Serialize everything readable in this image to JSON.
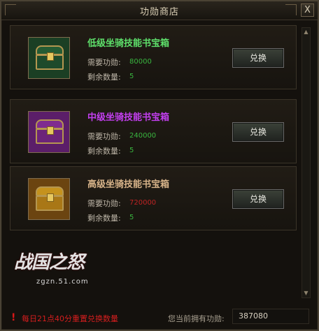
{
  "window": {
    "title": "功勋商店",
    "close_label": "X"
  },
  "items": [
    {
      "name": "低级坐骑技能书宝箱",
      "name_color": "#5ee06b",
      "icon": "green-treasure-chest-icon",
      "icon_colors": {
        "frame": "#1b3f24",
        "body": "#255c34"
      },
      "cost_label": "需要功勋:",
      "cost_value": "80000",
      "cost_color": "#39b53f",
      "remain_label": "剩余数量:",
      "remain_value": "5",
      "button_label": "兑换"
    },
    {
      "name": "中级坐骑技能书宝箱",
      "name_color": "#c33ff0",
      "icon": "purple-treasure-chest-icon",
      "icon_colors": {
        "frame": "#5b1e69",
        "body": "#7f2b8f"
      },
      "cost_label": "需要功勋:",
      "cost_value": "240000",
      "cost_color": "#39b53f",
      "remain_label": "剩余数量:",
      "remain_value": "5",
      "button_label": "兑换"
    },
    {
      "name": "高级坐骑技能书宝箱",
      "name_color": "#d8b48a",
      "icon": "golden-treasure-chest-icon",
      "icon_colors": {
        "frame": "#6b4410",
        "body": "#c5921d"
      },
      "cost_label": "需要功勋:",
      "cost_value": "720000",
      "cost_color": "#bf2323",
      "remain_label": "剩余数量:",
      "remain_value": "5",
      "button_label": "兑换"
    }
  ],
  "branding": {
    "logo_text": "战国之怒",
    "logo_url": "zgzn.51.com"
  },
  "footer": {
    "reset_note": "每日21点40分重置兑换数量",
    "owned_label": "您当前拥有功勋:",
    "owned_value": "387080"
  },
  "colors": {
    "background": "#14110d",
    "border": "#4a4234",
    "warning": "#d61e1e"
  }
}
